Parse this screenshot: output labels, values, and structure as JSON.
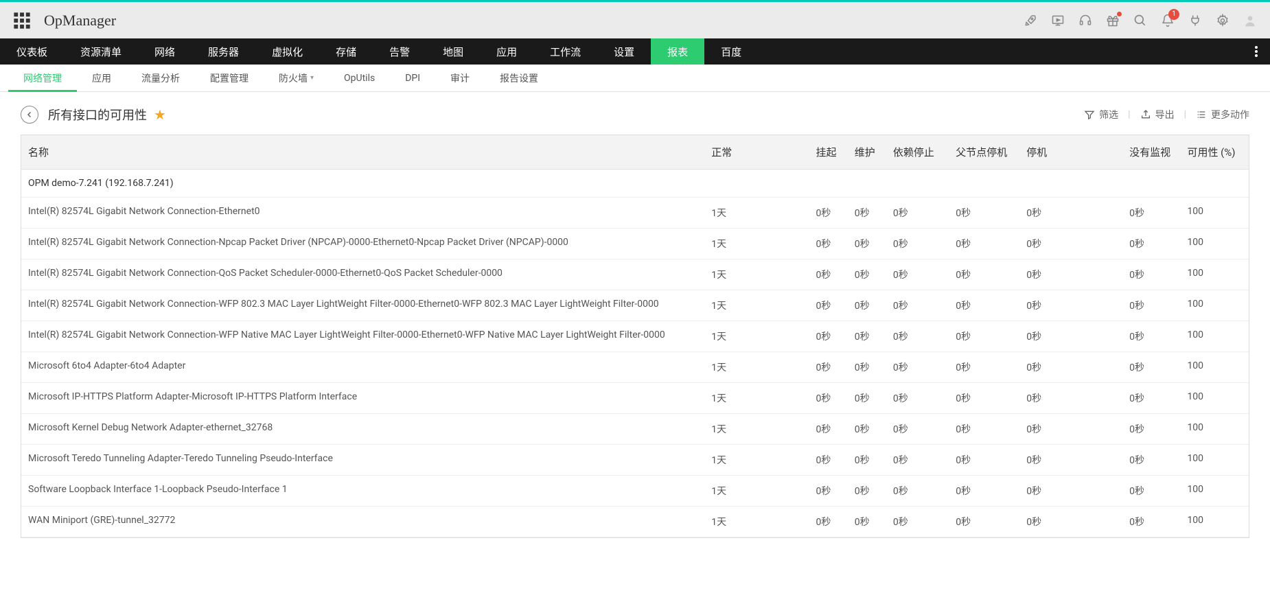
{
  "brand": "OpManager",
  "notification_count": "1",
  "mainnav": [
    {
      "label": "仪表板"
    },
    {
      "label": "资源清单"
    },
    {
      "label": "网络"
    },
    {
      "label": "服务器"
    },
    {
      "label": "虚拟化"
    },
    {
      "label": "存储"
    },
    {
      "label": "告警"
    },
    {
      "label": "地图"
    },
    {
      "label": "应用"
    },
    {
      "label": "工作流"
    },
    {
      "label": "设置"
    },
    {
      "label": "报表",
      "active": true
    },
    {
      "label": "百度"
    }
  ],
  "subnav": [
    {
      "label": "网络管理",
      "active": true
    },
    {
      "label": "应用"
    },
    {
      "label": "流量分析"
    },
    {
      "label": "配置管理"
    },
    {
      "label": "防火墙",
      "chevron": true
    },
    {
      "label": "OpUtils"
    },
    {
      "label": "DPI"
    },
    {
      "label": "审计"
    },
    {
      "label": "报告设置"
    }
  ],
  "page_title": "所有接口的可用性",
  "actions": {
    "filter": "筛选",
    "export": "导出",
    "more": "更多动作"
  },
  "columns": {
    "name": "名称",
    "normal": "正常",
    "suspend": "挂起",
    "maint": "维护",
    "depstop": "依赖停止",
    "parentstop": "父节点停机",
    "down": "停机",
    "nomon": "没有监视",
    "avail": "可用性 (%)"
  },
  "group_label": "OPM demo-7.241 (192.168.7.241)",
  "rows": [
    {
      "name": "Intel(R) 82574L Gigabit Network Connection-Ethernet0",
      "normal": "1天",
      "suspend": "0秒",
      "maint": "0秒",
      "depstop": "0秒",
      "parentstop": "0秒",
      "down": "0秒",
      "nomon": "0秒",
      "avail": "100"
    },
    {
      "name": "Intel(R) 82574L Gigabit Network Connection-Npcap Packet Driver (NPCAP)-0000-Ethernet0-Npcap Packet Driver (NPCAP)-0000",
      "normal": "1天",
      "suspend": "0秒",
      "maint": "0秒",
      "depstop": "0秒",
      "parentstop": "0秒",
      "down": "0秒",
      "nomon": "0秒",
      "avail": "100"
    },
    {
      "name": "Intel(R) 82574L Gigabit Network Connection-QoS Packet Scheduler-0000-Ethernet0-QoS Packet Scheduler-0000",
      "normal": "1天",
      "suspend": "0秒",
      "maint": "0秒",
      "depstop": "0秒",
      "parentstop": "0秒",
      "down": "0秒",
      "nomon": "0秒",
      "avail": "100"
    },
    {
      "name": "Intel(R) 82574L Gigabit Network Connection-WFP 802.3 MAC Layer LightWeight Filter-0000-Ethernet0-WFP 802.3 MAC Layer LightWeight Filter-0000",
      "normal": "1天",
      "suspend": "0秒",
      "maint": "0秒",
      "depstop": "0秒",
      "parentstop": "0秒",
      "down": "0秒",
      "nomon": "0秒",
      "avail": "100"
    },
    {
      "name": "Intel(R) 82574L Gigabit Network Connection-WFP Native MAC Layer LightWeight Filter-0000-Ethernet0-WFP Native MAC Layer LightWeight Filter-0000",
      "normal": "1天",
      "suspend": "0秒",
      "maint": "0秒",
      "depstop": "0秒",
      "parentstop": "0秒",
      "down": "0秒",
      "nomon": "0秒",
      "avail": "100"
    },
    {
      "name": "Microsoft 6to4 Adapter-6to4 Adapter",
      "normal": "1天",
      "suspend": "0秒",
      "maint": "0秒",
      "depstop": "0秒",
      "parentstop": "0秒",
      "down": "0秒",
      "nomon": "0秒",
      "avail": "100"
    },
    {
      "name": "Microsoft IP-HTTPS Platform Adapter-Microsoft IP-HTTPS Platform Interface",
      "normal": "1天",
      "suspend": "0秒",
      "maint": "0秒",
      "depstop": "0秒",
      "parentstop": "0秒",
      "down": "0秒",
      "nomon": "0秒",
      "avail": "100"
    },
    {
      "name": "Microsoft Kernel Debug Network Adapter-ethernet_32768",
      "normal": "1天",
      "suspend": "0秒",
      "maint": "0秒",
      "depstop": "0秒",
      "parentstop": "0秒",
      "down": "0秒",
      "nomon": "0秒",
      "avail": "100"
    },
    {
      "name": "Microsoft Teredo Tunneling Adapter-Teredo Tunneling Pseudo-Interface",
      "normal": "1天",
      "suspend": "0秒",
      "maint": "0秒",
      "depstop": "0秒",
      "parentstop": "0秒",
      "down": "0秒",
      "nomon": "0秒",
      "avail": "100"
    },
    {
      "name": "Software Loopback Interface 1-Loopback Pseudo-Interface 1",
      "normal": "1天",
      "suspend": "0秒",
      "maint": "0秒",
      "depstop": "0秒",
      "parentstop": "0秒",
      "down": "0秒",
      "nomon": "0秒",
      "avail": "100"
    },
    {
      "name": "WAN Miniport (GRE)-tunnel_32772",
      "normal": "1天",
      "suspend": "0秒",
      "maint": "0秒",
      "depstop": "0秒",
      "parentstop": "0秒",
      "down": "0秒",
      "nomon": "0秒",
      "avail": "100"
    }
  ]
}
